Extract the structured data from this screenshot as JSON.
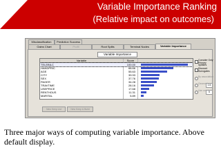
{
  "slide": {
    "title": "Variable Importance Ranking",
    "subtitle": "(Relative impact on outcomes)",
    "caption": "Three major ways of computing variable importance. Above default display."
  },
  "tabs_top": [
    "Misclassification",
    "Prediction Success"
  ],
  "tabs_bottom": [
    "Gains Chart",
    "Profit",
    "Root Splits",
    "Terminal Nodes",
    "Variable Importance"
  ],
  "panel": {
    "caption": "Variable Importance",
    "columns": [
      "Variable",
      "Score"
    ],
    "rows": [
      {
        "name": "TELEBILC",
        "score": "100.00",
        "value": 100
      },
      {
        "name": "HANDPRIC",
        "score": "68.66",
        "value": 68.66
      },
      {
        "name": "AGE",
        "score": "55.63",
        "value": 55.63
      },
      {
        "name": "CITY",
        "score": "39.93",
        "value": 39.93
      },
      {
        "name": "SEX",
        "score": "37.76",
        "value": 37.76
      },
      {
        "name": "PAGER",
        "score": "34.28",
        "value": 34.28
      },
      {
        "name": "TRAVTIME",
        "score": "28.16",
        "value": 28.16
      },
      {
        "name": "USEPRICE",
        "score": "17.68",
        "value": 17.68
      },
      {
        "name": "RENTHOUS",
        "score": "11.31",
        "value": 11.31
      },
      {
        "name": "MARITAL",
        "score": "5.89",
        "value": 5.89
      }
    ],
    "options": {
      "consider_only_primary": "Consider Only Primary Splitters",
      "discount_surrogates": "Discount Surrogates",
      "by_association": "By association",
      "geometric": "Geometric",
      "geometric_value": "0.5",
      "use_only_top": "Use only top",
      "use_only_top_value": "5"
    },
    "buttons": [
      "New Keep List",
      "New Keep & Build"
    ]
  }
}
